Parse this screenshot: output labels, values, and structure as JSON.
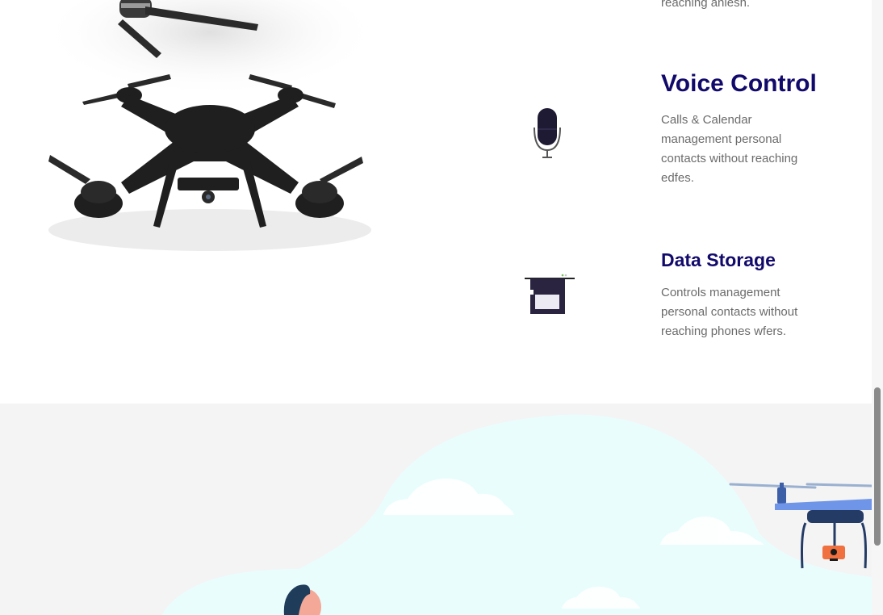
{
  "features": {
    "previous_desc_tail": "reaching anlesh.",
    "voice": {
      "icon": "microphone-icon",
      "title": "Voice Control",
      "description": "Calls & Calendar management personal contacts without reaching edfes."
    },
    "storage": {
      "icon": "sd-card-icon",
      "title": "Data Storage",
      "description": "Controls management personal contacts without reaching phones wfers."
    }
  },
  "colors": {
    "title": "#120a6b",
    "body_text": "#6b6b6b",
    "illustration_bg": "#f4f4f4",
    "sky_blob": "#e9fdfd",
    "drone_blue": "#6f95e8",
    "camera_orange": "#f0703f"
  }
}
